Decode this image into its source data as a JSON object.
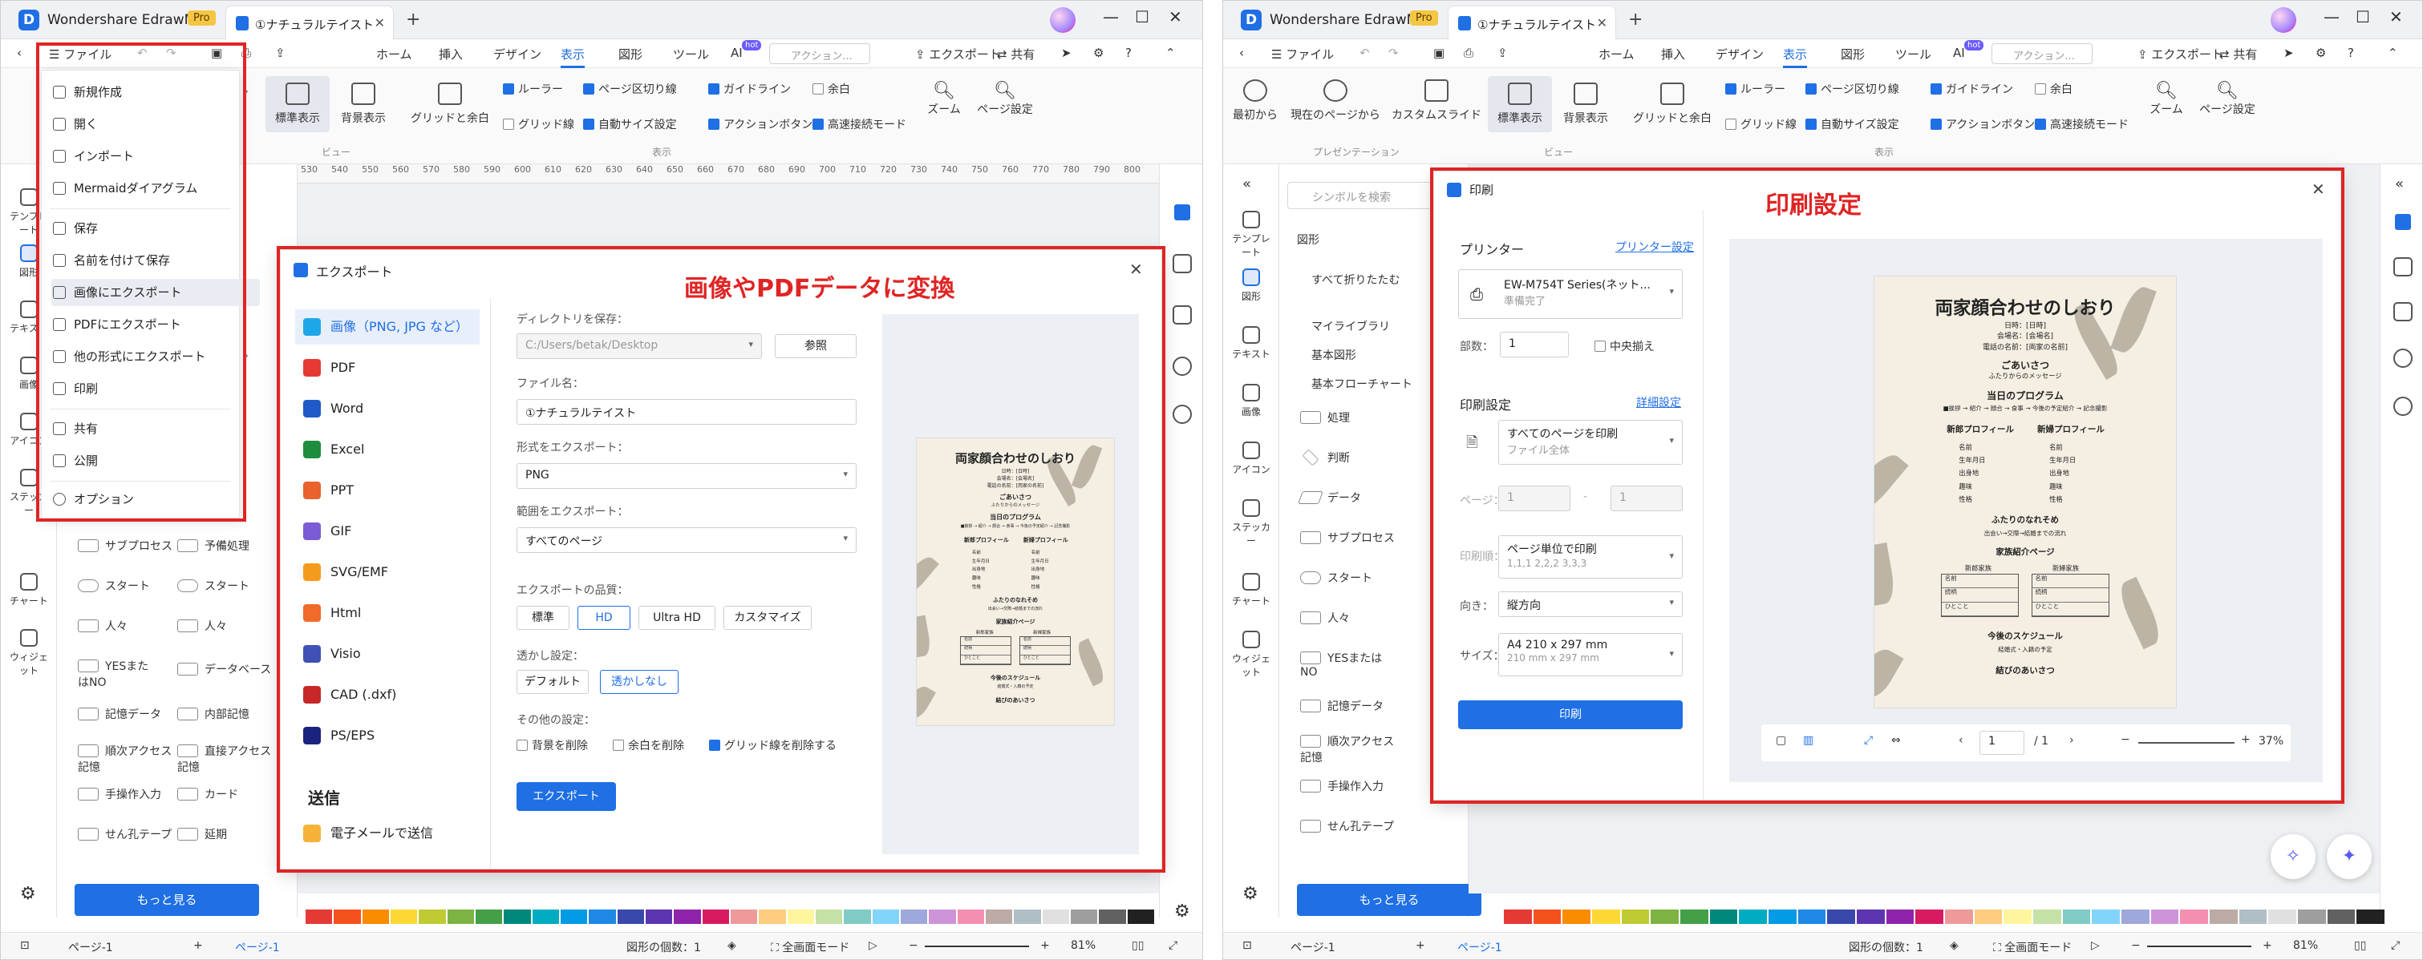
{
  "app": {
    "brand": "Wondershare EdrawMax",
    "pro": "Pro",
    "tab": "①ナチュラルテイスト"
  },
  "menu": {
    "file": "ファイル",
    "home": "ホーム",
    "insert": "挿入",
    "design": "デザイン",
    "view": "表示",
    "shape": "図形",
    "tools": "ツール",
    "ai": "AI",
    "hot": "hot",
    "search_placeholder": "アクション...",
    "export": "エクスポート",
    "share": "共有"
  },
  "ribbon": {
    "first_page": "最初から",
    "current_page": "現在のページから",
    "custom_slide": "カスタムスライド",
    "standard_view": "標準表示",
    "bg_view": "背景表示",
    "grid_margin": "グリッドと余白",
    "ruler": "ルーラー",
    "page_break": "ページ区切り線",
    "guide": "ガイドライン",
    "margin": "余白",
    "grid_line": "グリッド線",
    "auto_size": "自動サイズ設定",
    "action_btn": "アクションボタン",
    "hs_connect": "高速接続モード",
    "zoom": "ズーム",
    "page_setup": "ページ設定",
    "group_presentation": "プレゼンテーション",
    "group_view": "ビュー",
    "group_display": "表示"
  },
  "left_sidebar": {
    "template": "テンプレート",
    "shape": "図形",
    "text": "テキスト",
    "image": "画像",
    "icon": "アイコン",
    "sticker": "ステッカー",
    "chart": "チャート",
    "widget": "ウィジェット"
  },
  "library": {
    "search_placeholder": "シンボルを検索",
    "shape_header": "図形",
    "collapse_all": "すべて折りたたむ",
    "my_library": "マイライブラリ",
    "basic_shapes": "基本図形",
    "basic_flowchart": "基本フローチャート",
    "shapes": [
      "処理",
      "判断",
      "データ",
      "サブプロセス",
      "スタート",
      "人々",
      "YESまたはNO",
      "記憶データ",
      "順次アクセス記憶",
      "手操作入力",
      "せん孔テープ"
    ],
    "shapes_right": [
      "予備処理",
      "スタート",
      "人々",
      "データベース",
      "内部記憶",
      "直接アクセス記憶",
      "カード",
      "延期"
    ],
    "more": "もっと見る"
  },
  "file_menu": {
    "items": [
      "新規作成",
      "開く",
      "インポート",
      "Mermaidダイアグラム",
      "保存",
      "名前を付けて保存",
      "画像にエクスポート",
      "PDFにエクスポート",
      "他の形式にエクスポート",
      "印刷",
      "共有",
      "公開",
      "オプション"
    ]
  },
  "ruler_marks": [
    "530",
    "540",
    "550",
    "560",
    "570",
    "580",
    "590",
    "600",
    "610",
    "620",
    "630",
    "640",
    "650",
    "660",
    "670",
    "680",
    "690",
    "700",
    "710",
    "720",
    "730",
    "740",
    "750",
    "760",
    "770",
    "780",
    "790",
    "800"
  ],
  "export_dialog": {
    "title": "エクスポート",
    "annotation": "画像やPDFデータに変換",
    "formats": [
      "画像（PNG, JPG など）",
      "PDF",
      "Word",
      "Excel",
      "PPT",
      "GIF",
      "SVG/EMF",
      "Html",
      "Visio",
      "CAD (.dxf)",
      "PS/EPS"
    ],
    "send_header": "送信",
    "send_email": "電子メールで送信",
    "dir_label": "ディレクトリを保存：",
    "dir_value": "C:/Users/betak/Desktop",
    "browse": "参照",
    "filename_label": "ファイル名：",
    "filename_value": "①ナチュラルテイスト",
    "format_label": "形式をエクスポート：",
    "format_value": "PNG",
    "range_label": "範囲をエクスポート：",
    "range_value": "すべてのページ",
    "quality_label": "エクスポートの品質：",
    "quality": [
      "標準",
      "HD",
      "Ultra HD",
      "カスタマイズ"
    ],
    "transparent_label": "透かし設定：",
    "transparent": [
      "デフォルト",
      "透かしなし"
    ],
    "other_label": "その他の設定：",
    "other": [
      "背景を削除",
      "余白を削除",
      "グリッド線を削除する"
    ],
    "export_btn": "エクスポート"
  },
  "print_dialog": {
    "title": "印刷",
    "annotation": "印刷設定",
    "printer_label": "プリンター",
    "printer_settings": "プリンター設定",
    "printer_name": "EW-M754T Series(ネット...",
    "printer_status": "準備完了",
    "copies_label": "部数：",
    "copies_value": "1",
    "collate": "中央揃え",
    "print_settings_label": "印刷設定",
    "detail_settings": "詳細設定",
    "all_pages": "すべてのページを印刷",
    "whole_file": "ファイル全体",
    "page_label": "ページ：",
    "page_from": "1",
    "page_to": "1",
    "order_label": "印刷順：",
    "order_value": "ページ単位で印刷",
    "order_sub": "1,1,1 2,2,2 3,3,3",
    "orient_label": "向き：",
    "orient_value": "縦方向",
    "size_label": "サイズ：",
    "size_value": "A4 210 x 297 mm",
    "size_sub": "210 mm x 297 mm",
    "print_btn": "印刷",
    "page_current": "1",
    "page_total": "/ 1",
    "zoom": "37%"
  },
  "poster": {
    "title": "両家顔合わせのしおり",
    "lines": [
      "日時：[日時]",
      "会場名：[会場名]",
      "電話の名前：[両家の名前]"
    ],
    "greeting": "ごあいさつ",
    "greeting_sub": "ふたりからのメッセージ",
    "program": "当日のプログラム",
    "program_sub": "■挨拶 → 紹介 → 顔合 → 食事 → 今後の予定紹介 → 記念撮影",
    "profile_l": "新郎プロフィール",
    "profile_r": "新婦プロフィール",
    "fields": [
      "名前",
      "生年月日",
      "出身地",
      "趣味",
      "性格"
    ],
    "meet": "ふたりのなれそめ",
    "meet_sub": "出会い→交際→結婚までの流れ",
    "family": "家族紹介ページ",
    "family_l": "新郎家族",
    "family_r": "新婦家族",
    "tbl_rows": [
      "名前",
      "続柄",
      "ひとこと"
    ],
    "schedule": "今後のスケジュール",
    "schedule_sub": "結婚式・入籍の予定",
    "closing": "結びのあいさつ"
  },
  "status": {
    "page_sel": "ページ-1",
    "page_tab": "ページ-1",
    "shape_count": "図形の個数：1",
    "fullscreen": "全画面モード",
    "zoom": "81%"
  },
  "colors": {
    "accent": "#1f6fe5",
    "annotation": "#e02424"
  },
  "palette": [
    "#e53935",
    "#f4511e",
    "#fb8c00",
    "#fdd835",
    "#c0ca33",
    "#7cb342",
    "#43a047",
    "#00897b",
    "#00acc1",
    "#039be5",
    "#1e88e5",
    "#3949ab",
    "#5e35b1",
    "#8e24aa",
    "#d81b60",
    "#ef9a9a",
    "#ffcc80",
    "#fff59d",
    "#c5e1a5",
    "#80cbc4",
    "#81d4fa",
    "#9fa8da",
    "#ce93d8",
    "#f48fb1",
    "#bcaaa4",
    "#b0bec5",
    "#e0e0e0",
    "#9e9e9e",
    "#616161",
    "#212121"
  ]
}
